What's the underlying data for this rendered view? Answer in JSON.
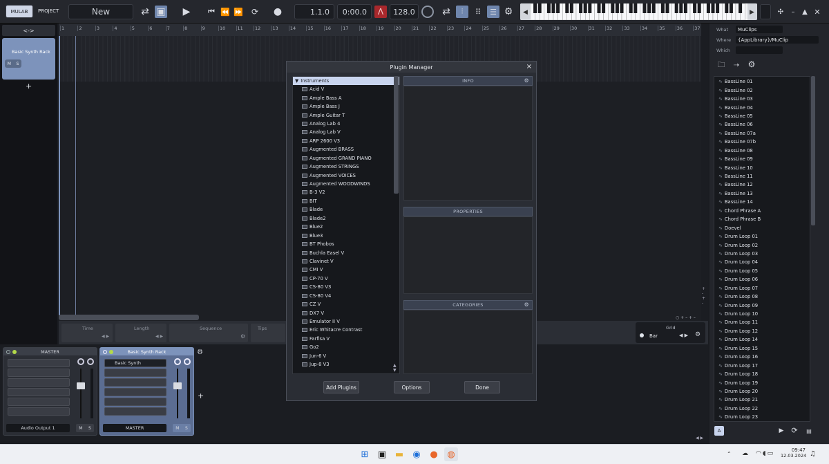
{
  "topbar": {
    "mulab": "MULAB",
    "project": "PROJECT",
    "project_name": "New",
    "position": "1.1.0",
    "time": "0:00.0",
    "tempo": "128.0"
  },
  "ruler_numbers": [
    "1",
    "2",
    "3",
    "4",
    "5",
    "6",
    "7",
    "8",
    "9",
    "10",
    "11",
    "12",
    "13",
    "14",
    "15",
    "16",
    "17",
    "18",
    "19",
    "20",
    "21",
    "22",
    "23",
    "24",
    "25",
    "26",
    "27",
    "28",
    "29",
    "30",
    "31",
    "32",
    "33",
    "34",
    "35",
    "36",
    "37"
  ],
  "track": {
    "name": "Basic Synth Rack",
    "mute": "M",
    "solo": "S",
    "add": "+",
    "arrows": "<->"
  },
  "bottom_params": {
    "time": "Time",
    "length": "Length",
    "sequence": "Sequence",
    "tips": "Tips",
    "grid": "Grid",
    "grid_value": "Bar"
  },
  "mixer": {
    "master_title": "MASTER",
    "rack_title": "Basic Synth Rack",
    "synth_slot": "Basic Synth",
    "master_output": "Audio Output 1",
    "rack_output": "MASTER",
    "m": "M",
    "s": "S",
    "add": "+"
  },
  "dialog": {
    "title": "Plugin Manager",
    "close": "×",
    "category": "Instruments",
    "plugins": [
      "Acid V",
      "Ample Bass A",
      "Ample Bass J",
      "Ample Guitar T",
      "Analog Lab 4",
      "Analog Lab V",
      "ARP 2600 V3",
      "Augmented BRASS",
      "Augmented GRAND PIANO",
      "Augmented STRINGS",
      "Augmented VOICES",
      "Augmented WOODWINDS",
      "B-3 V2",
      "BIT",
      "Blade",
      "Blade2",
      "Blue2",
      "Blue3",
      "BT Phobos",
      "Buchla Easel V",
      "Clavinet V",
      "CMI V",
      "CP-70 V",
      "CS-80 V3",
      "CS-80 V4",
      "CZ V",
      "DX7 V",
      "Emulator II V",
      "Eric Whitacre Contrast",
      "Farfisa V",
      "Go2",
      "Jun-6 V",
      "Jup-8 V3"
    ],
    "info": "INFO",
    "properties": "PROPERTIES",
    "categories": "CATEGORIES",
    "add_plugins": "Add Plugins",
    "options": "Options",
    "done": "Done"
  },
  "browser": {
    "what_label": "What",
    "what_value": "MuClips",
    "where_label": "Where",
    "where_value": "{AppLibrary}/MuClip",
    "which_label": "Which",
    "items": [
      "BassLine 01",
      "BassLine 02",
      "BassLine 03",
      "BassLine 04",
      "BassLine 05",
      "BassLine 06",
      "BassLine 07a",
      "BassLine 07b",
      "BassLine 08",
      "BassLine 09",
      "BassLine 10",
      "BassLine 11",
      "BassLine 12",
      "BassLine 13",
      "BassLine 14",
      "Chord Phrase A",
      "Chord Phrase B",
      "Doevel",
      "Drum Loop 01",
      "Drum Loop 02",
      "Drum Loop 03",
      "Drum Loop 04",
      "Drum Loop 05",
      "Drum Loop 06",
      "Drum Loop 07",
      "Drum Loop 08",
      "Drum Loop 09",
      "Drum Loop 10",
      "Drum Loop 11",
      "Drum Loop 12",
      "Drum Loop 14",
      "Drum Loop 15",
      "Drum Loop 16",
      "Drum Loop 17",
      "Drum Loop 18",
      "Drum Loop 19",
      "Drum Loop 20",
      "Drum Loop 21",
      "Drum Loop 22",
      "Drum Loop 23"
    ],
    "a_button": "A"
  },
  "taskbar": {
    "time": "09:47",
    "date": "12.03.2024"
  }
}
